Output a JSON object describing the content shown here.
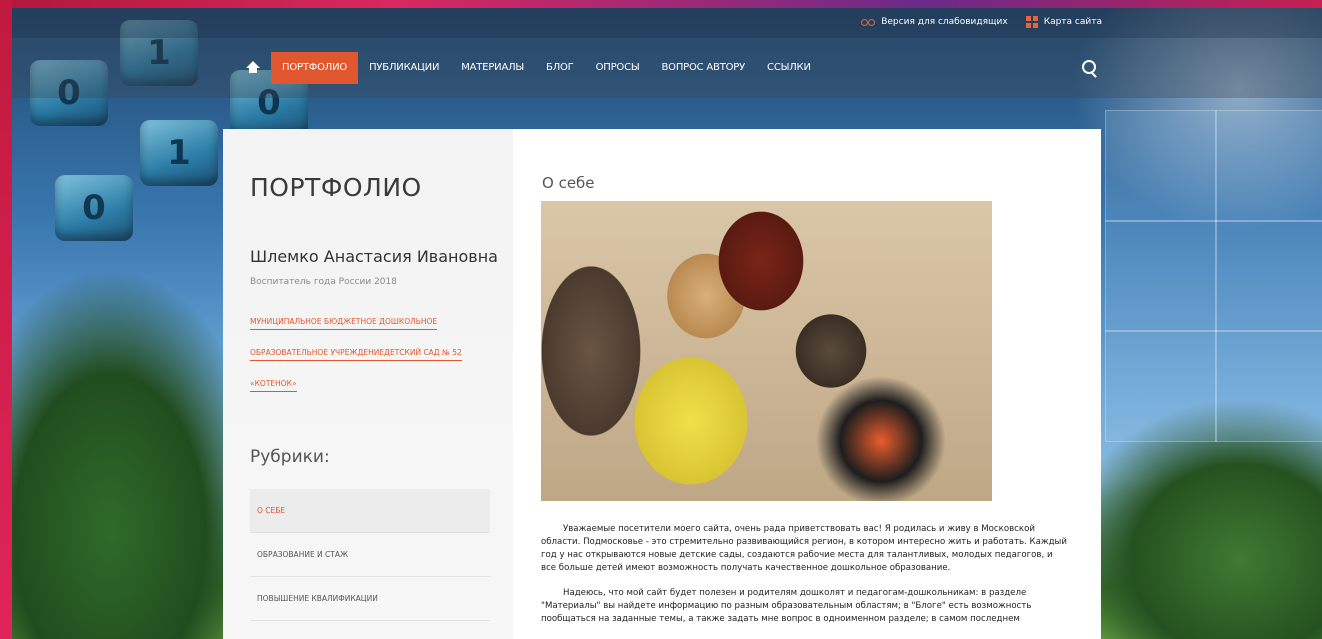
{
  "topbar": {
    "vision_label": "Версия для слабовидящих",
    "sitemap_label": "Карта сайта"
  },
  "nav": {
    "items": [
      {
        "label": "ПОРТФОЛИО",
        "active": true
      },
      {
        "label": "ПУБЛИКАЦИИ"
      },
      {
        "label": "МАТЕРИАЛЫ"
      },
      {
        "label": "БЛОГ"
      },
      {
        "label": "ОПРОСЫ"
      },
      {
        "label": "ВОПРОС АВТОРУ"
      },
      {
        "label": "ССЫЛКИ"
      }
    ]
  },
  "sidebar": {
    "page_title": "ПОРТФОЛИО",
    "person_name": "Шлемко Анастасия Ивановна",
    "person_title": "Воспитатель года России 2018",
    "org_lines": [
      "МУНИЦИПАЛЬНОЕ БЮДЖЕТНОЕ ДОШКОЛЬНОЕ",
      "ОБРАЗОВАТЕЛЬНОЕ УЧРЕЖДЕНИЕДЕТСКИЙ САД № 52",
      "«КОТЕНОК»"
    ],
    "rubrics_title": "Рубрики:",
    "rubrics": [
      {
        "label": "О СЕБЕ",
        "active": true
      },
      {
        "label": "ОБРАЗОВАНИЕ И СТАЖ"
      },
      {
        "label": "ПОВЫШЕНИЕ КВАЛИФИКАЦИИ"
      }
    ]
  },
  "main": {
    "section_title": "О себе",
    "paragraphs": [
      "Уважаемые посетители моего сайта, очень рада приветствовать вас! Я родилась и живу в Московской области. Подмосковье - это стремительно развивающийся регион, в котором интересно жить и работать. Каждый год у нас открываются новые детские сады, создаются рабочие места для талантливых, молодых педагогов, и все больше детей имеют возможность получать качественное дошкольное образование.",
      "Надеюсь, что мой сайт будет полезен и родителям дошколят и педагогам-дошкольникам: в разделе \"Материалы\" вы найдете информацию по разным образовательным областям; в \"Блоге\" есть возможность пообщаться на заданные темы, а также задать мне вопрос в одноименном разделе; в самом последнем"
    ]
  },
  "colors": {
    "accent": "#e0572f",
    "nav_bg": "rgba(60,70,80,0.35)"
  },
  "icons": [
    "home-icon",
    "search-icon",
    "glasses-icon",
    "sitemap-icon"
  ]
}
